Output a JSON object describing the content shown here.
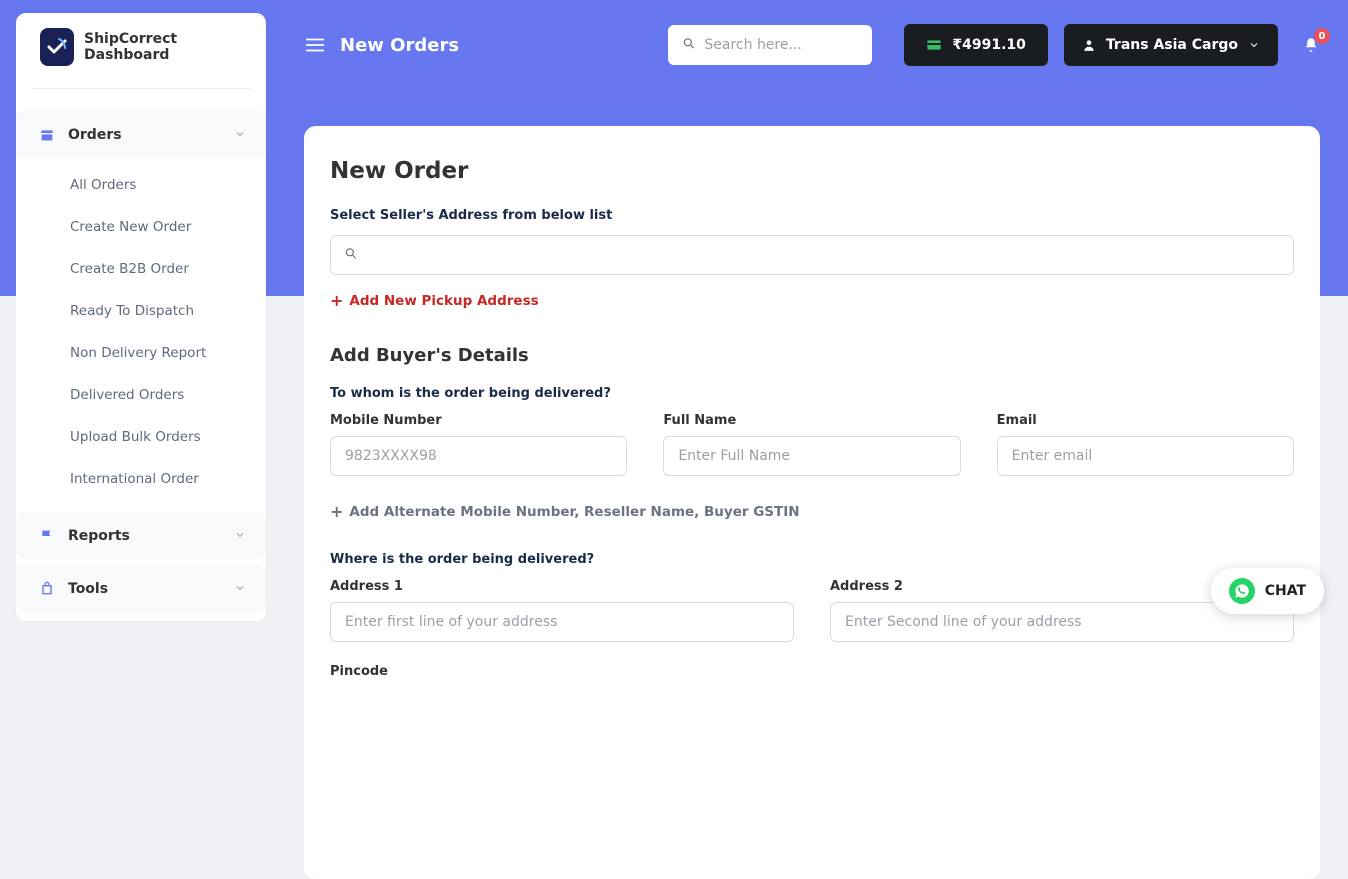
{
  "app": {
    "title": "ShipCorrect Dashboard"
  },
  "sidebar": {
    "orders": {
      "label": "Orders",
      "items": [
        "All Orders",
        "Create New Order",
        "Create B2B Order",
        "Ready To Dispatch",
        "Non Delivery Report",
        "Delivered Orders",
        "Upload Bulk Orders",
        "International Order"
      ]
    },
    "reports": {
      "label": "Reports"
    },
    "tools": {
      "label": "Tools"
    }
  },
  "header": {
    "title": "New Orders",
    "search_placeholder": "Search here...",
    "balance": "₹4991.10",
    "user_name": "Trans Asia Cargo",
    "notif_count": "0"
  },
  "form": {
    "heading": "New Order",
    "seller_label": "Select Seller's Address from below list",
    "add_pickup": "Add New Pickup Address",
    "buyer_heading": "Add Buyer's Details",
    "buyer_sub": "To whom is the order being delivered?",
    "mobile": {
      "label": "Mobile Number",
      "placeholder": "9823XXXX98"
    },
    "name": {
      "label": "Full Name",
      "placeholder": "Enter Full Name"
    },
    "email": {
      "label": "Email",
      "placeholder": "Enter email"
    },
    "alt_link": "Add Alternate Mobile Number, Reseller Name, Buyer GSTIN",
    "where_sub": "Where is the order being delivered?",
    "addr1": {
      "label": "Address 1",
      "placeholder": "Enter first line of your address"
    },
    "addr2": {
      "label": "Address 2",
      "placeholder": "Enter Second line of your address"
    },
    "pincode_label": "Pincode"
  },
  "chat": {
    "label": "CHAT"
  }
}
